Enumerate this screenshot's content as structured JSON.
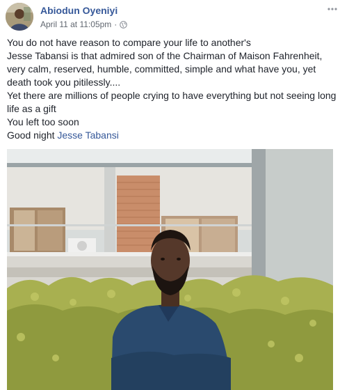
{
  "post": {
    "author": "Abiodun Oyeniyi",
    "timestamp": "April 11 at 11:05pm",
    "separator": "·",
    "privacy_icon": "globe-icon",
    "more_icon": "more-options-icon",
    "lines": [
      "You do not have reason to compare your life to another's",
      "Jesse Tabansi is that admired son of the Chairman of Maison Fahrenheit,",
      "very calm, reserved, humble, committed, simple and what have you, yet",
      "death took you pitilessly....",
      "Yet there are millions of people crying to have everything but not seeing long",
      "life as a gift",
      "You left too soon"
    ],
    "last_line_prefix": "Good night ",
    "mention": "Jesse Tabansi"
  },
  "colors": {
    "link": "#365899",
    "text": "#1d2129",
    "meta": "#616770"
  }
}
